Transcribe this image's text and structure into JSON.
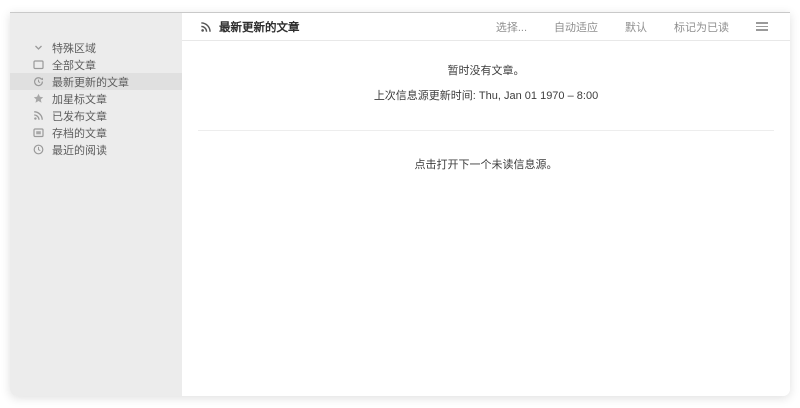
{
  "sidebar": {
    "items": [
      {
        "label": "特殊区域",
        "icon": "chevron-down-icon",
        "selected": false
      },
      {
        "label": "全部文章",
        "icon": "folder-icon",
        "selected": false
      },
      {
        "label": "最新更新的文章",
        "icon": "fresh-icon",
        "selected": true
      },
      {
        "label": "加星标文章",
        "icon": "star-icon",
        "selected": false
      },
      {
        "label": "已发布文章",
        "icon": "rss-icon",
        "selected": false
      },
      {
        "label": "存档的文章",
        "icon": "archive-icon",
        "selected": false
      },
      {
        "label": "最近的阅读",
        "icon": "clock-icon",
        "selected": false
      }
    ]
  },
  "header": {
    "title": "最新更新的文章",
    "title_icon": "rss-icon",
    "toolbar": {
      "select_label": "选择...",
      "view_mode_label": "自动适应",
      "sort_label": "默认",
      "mark_read_label": "标记为已读",
      "menu_icon": "hamburger-menu-icon"
    }
  },
  "content": {
    "empty_message": "暂时没有文章。",
    "last_update": "上次信息源更新时间: Thu, Jan 01 1970 – 8:00",
    "hint": "点击打开下一个未读信息源。"
  },
  "colors": {
    "sidebar_bg": "#ececec",
    "sidebar_selected_bg": "#e0e0e0",
    "header_border": "#e8e8e8",
    "toolbar_text": "#8f8f8f",
    "content_text": "#3d3d3d",
    "window_top_border": "#c9c9c9"
  }
}
